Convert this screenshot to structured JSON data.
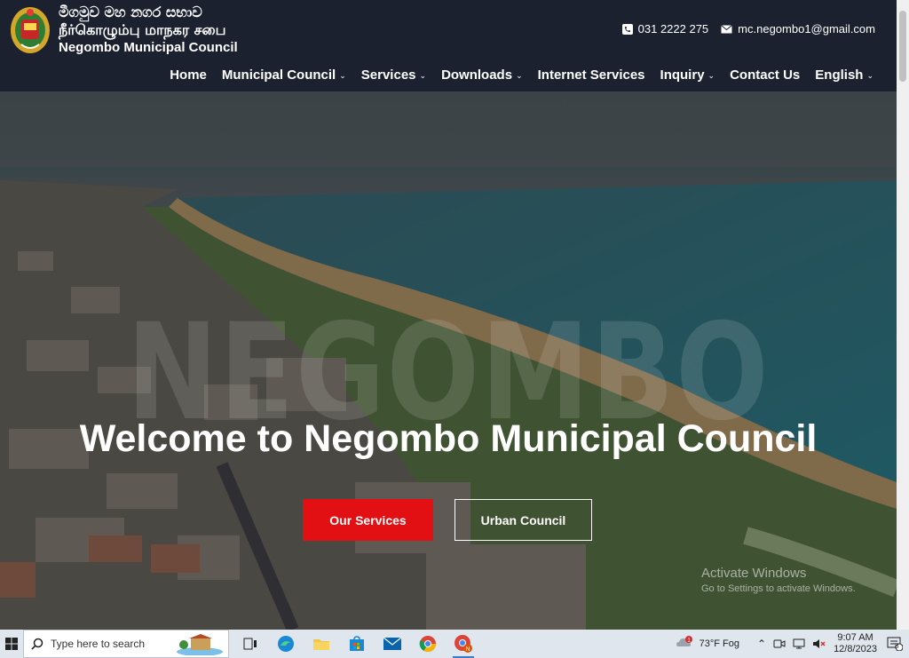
{
  "header": {
    "name_sinhala": "මීගමුව මහ නගර සභාව",
    "name_tamil": "நீர்கொழும்பு மாநகர சபை",
    "name_english": "Negombo Municipal Council",
    "phone": "031 2222 275",
    "email": "mc.negombo1@gmail.com"
  },
  "nav": {
    "items": [
      {
        "label": "Home",
        "dropdown": false
      },
      {
        "label": "Municipal Council",
        "dropdown": true
      },
      {
        "label": "Services",
        "dropdown": true
      },
      {
        "label": "Downloads",
        "dropdown": true
      },
      {
        "label": "Internet Services",
        "dropdown": false
      },
      {
        "label": "Inquiry",
        "dropdown": true
      },
      {
        "label": "Contact Us",
        "dropdown": false
      },
      {
        "label": "English",
        "dropdown": true
      }
    ]
  },
  "hero": {
    "watermark": "NEGOMBO",
    "title": "Welcome to Negombo Municipal Council",
    "primary_button": "Our Services",
    "secondary_button": "Urban Council"
  },
  "activation": {
    "title": "Activate Windows",
    "subtitle": "Go to Settings to activate Windows."
  },
  "taskbar": {
    "search_placeholder": "Type here to search",
    "weather": "73°F  Fog",
    "weather_badge": "1",
    "time": "9:07 AM",
    "date": "12/8/2023",
    "notification_count": "8",
    "apps": [
      "task-view-icon",
      "edge-icon",
      "file-explorer-icon",
      "store-icon",
      "mail-icon",
      "chrome-icon",
      "chrome-profile-icon"
    ]
  },
  "colors": {
    "header_bg": "#1c2130",
    "primary_button": "#e20f13"
  }
}
